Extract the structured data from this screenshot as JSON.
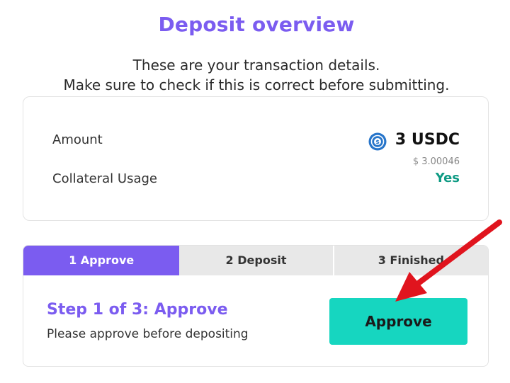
{
  "header": {
    "title": "Deposit overview",
    "subtitle_line1": "These are your transaction details.",
    "subtitle_line2": "Make sure to check if this is correct before submitting."
  },
  "details": {
    "amount_label": "Amount",
    "amount_value": "3 USDC",
    "amount_usd": "$ 3.00046",
    "token_icon": "usdc-icon",
    "collateral_label": "Collateral Usage",
    "collateral_value": "Yes"
  },
  "steps": {
    "tabs": [
      {
        "label": "1 Approve",
        "active": true
      },
      {
        "label": "2 Deposit",
        "active": false
      },
      {
        "label": "3 Finished",
        "active": false
      }
    ],
    "current_title": "Step 1 of 3: Approve",
    "current_description": "Please approve before depositing",
    "action_label": "Approve"
  },
  "colors": {
    "accent_purple": "#7b5cf0",
    "approve_teal": "#16d6c0",
    "yes_green": "#0f9b84",
    "annotation_arrow": "#e0141e"
  }
}
